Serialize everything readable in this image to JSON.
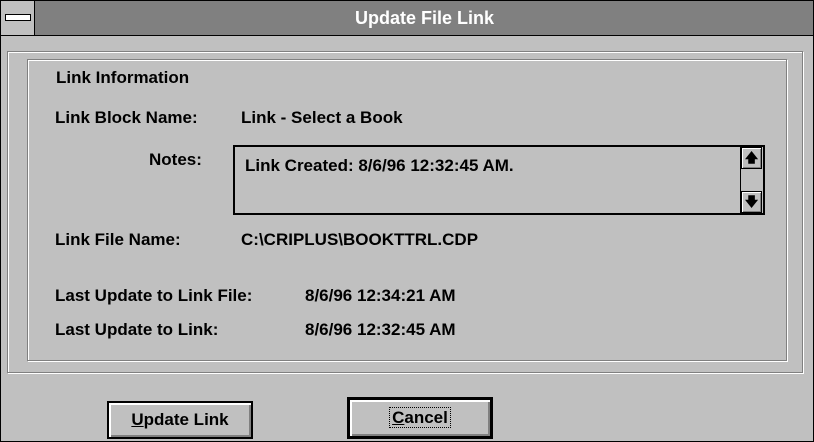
{
  "window": {
    "title": "Update File Link"
  },
  "group": {
    "label": "Link Information"
  },
  "fields": {
    "block_name_label": "Link Block Name:",
    "block_name_value": "Link - Select a Book",
    "notes_label": "Notes:",
    "notes_value": "Link Created:  8/6/96 12:32:45 AM.",
    "file_name_label": "Link File Name:",
    "file_name_value": "C:\\CRIPLUS\\BOOKTTRL.CDP",
    "last_update_file_label": "Last Update to Link File:",
    "last_update_file_value": "8/6/96 12:34:21 AM",
    "last_update_link_label": "Last Update to Link:",
    "last_update_link_value": "8/6/96 12:32:45 AM"
  },
  "buttons": {
    "update_mnemonic": "U",
    "update_rest": "pdate Link",
    "cancel_mnemonic": "C",
    "cancel_rest": "ancel"
  },
  "icons": {
    "system_menu": "system-menu-icon",
    "scroll_up": "up-arrow-icon",
    "scroll_down": "down-arrow-icon"
  }
}
